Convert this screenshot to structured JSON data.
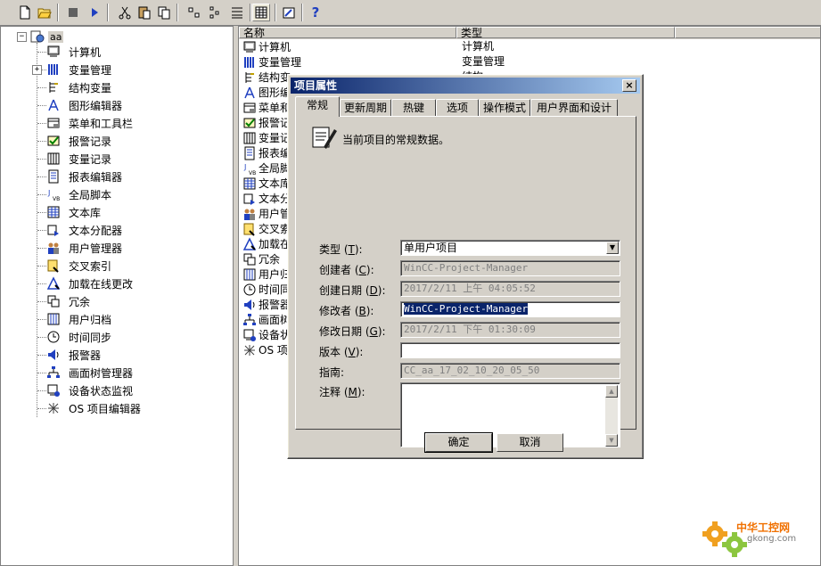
{
  "toolbar": {
    "buttons": [
      "new-file-icon",
      "open-folder-icon",
      "stop-icon",
      "play-icon",
      "cut-icon",
      "paste-icon",
      "copy-icon",
      "small-icons-icon",
      "list-view-icon",
      "details-view-icon",
      "grid-view-icon",
      "properties-icon",
      "help-icon"
    ],
    "help_glyph": "?"
  },
  "tree": {
    "root_label": "aa",
    "root_expander": "−",
    "var_expander": "+",
    "items": [
      {
        "label": "计算机",
        "icon": "computer-icon"
      },
      {
        "label": "变量管理",
        "icon": "tag-management-icon"
      },
      {
        "label": "结构变量",
        "icon": "struct-tag-icon"
      },
      {
        "label": "图形编辑器",
        "icon": "graphics-designer-icon"
      },
      {
        "label": "菜单和工具栏",
        "icon": "menu-toolbar-icon"
      },
      {
        "label": "报警记录",
        "icon": "alarm-logging-icon"
      },
      {
        "label": "变量记录",
        "icon": "tag-logging-icon"
      },
      {
        "label": "报表编辑器",
        "icon": "report-designer-icon"
      },
      {
        "label": "全局脚本",
        "icon": "global-script-icon"
      },
      {
        "label": "文本库",
        "icon": "text-library-icon"
      },
      {
        "label": "文本分配器",
        "icon": "text-distributor-icon"
      },
      {
        "label": "用户管理器",
        "icon": "user-administrator-icon"
      },
      {
        "label": "交叉索引",
        "icon": "cross-reference-icon"
      },
      {
        "label": "加载在线更改",
        "icon": "load-online-changes-icon"
      },
      {
        "label": "冗余",
        "icon": "redundancy-icon"
      },
      {
        "label": "用户归档",
        "icon": "user-archive-icon"
      },
      {
        "label": "时间同步",
        "icon": "time-sync-icon"
      },
      {
        "label": "报警器",
        "icon": "horn-icon"
      },
      {
        "label": "画面树管理器",
        "icon": "picture-tree-icon"
      },
      {
        "label": "设备状态监视",
        "icon": "device-status-icon"
      },
      {
        "label": "OS 项目编辑器",
        "icon": "os-project-editor-icon"
      }
    ]
  },
  "list": {
    "col_name": "名称",
    "col_type": "类型",
    "rows": [
      {
        "name": "计算机",
        "type": "计算机"
      },
      {
        "name": "变量管理",
        "type": "变量管理"
      },
      {
        "name": "结构变",
        "type": "结构"
      },
      {
        "name": "图形编",
        "type": ""
      },
      {
        "name": "菜单和",
        "type": ""
      },
      {
        "name": "报警记",
        "type": ""
      },
      {
        "name": "变量记",
        "type": ""
      },
      {
        "name": "报表编",
        "type": ""
      },
      {
        "name": "全局脚",
        "type": ""
      },
      {
        "name": "文本库",
        "type": ""
      },
      {
        "name": "文本分",
        "type": ""
      },
      {
        "name": "用户管",
        "type": ""
      },
      {
        "name": "交叉索",
        "type": ""
      },
      {
        "name": "加载在",
        "type": ""
      },
      {
        "name": "冗余",
        "type": ""
      },
      {
        "name": "用户归",
        "type": ""
      },
      {
        "name": "时间同",
        "type": ""
      },
      {
        "name": "报警器",
        "type": ""
      },
      {
        "name": "画面树",
        "type": ""
      },
      {
        "name": "设备状",
        "type": ""
      },
      {
        "name": "OS 项",
        "type": ""
      }
    ]
  },
  "dialog": {
    "title": "项目属性",
    "close": "×",
    "tabs": [
      "常规",
      "更新周期",
      "热键",
      "选项",
      "操作模式",
      "用户界面和设计"
    ],
    "header_text": "当前项目的常规数据。",
    "fields": {
      "type_label": "类型",
      "type_key": "T",
      "type_value": "单用户项目",
      "type_arrow": "▼",
      "creator_label": "创建者",
      "creator_key": "C",
      "creator_value": "WinCC-Project-Manager",
      "created_label": "创建日期",
      "created_key": "D",
      "created_value": "2017/2/11 上午 04:05:52",
      "modifier_label": "修改者",
      "modifier_key": "B",
      "modifier_value": "WinCC-Project-Manager",
      "modified_label": "修改日期",
      "modified_key": "G",
      "modified_value": "2017/2/11 下午 01:30:09",
      "version_label": "版本",
      "version_key": "V",
      "version_value": "",
      "guide_label": "指南",
      "guide_value": "CC_aa_17_02_10_20_05_50",
      "notes_label": "注释",
      "notes_key": "M",
      "notes_value": ""
    },
    "scroll_up": "▲",
    "scroll_down": "▼",
    "ok_label": "确定",
    "cancel_label": "取消"
  },
  "watermark": {
    "title": "中华工控网",
    "url": "gkong.com"
  },
  "colors": {
    "title_bar_start": "#0a246a",
    "title_bar_end": "#a6caf0",
    "face": "#d4d0c8",
    "watermark_orange": "#f07000",
    "watermark_green": "#8cc63f"
  }
}
